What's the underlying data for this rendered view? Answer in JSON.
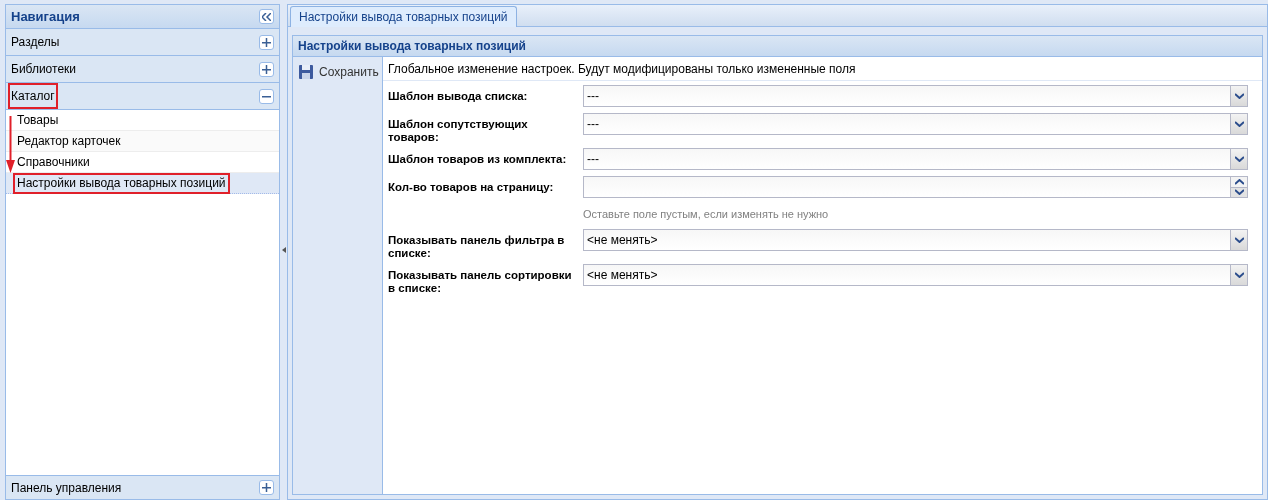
{
  "navigation": {
    "title": "Навигация",
    "sections": [
      {
        "label": "Разделы",
        "expanded": false,
        "highlighted": false
      },
      {
        "label": "Библиотеки",
        "expanded": false,
        "highlighted": false
      },
      {
        "label": "Каталог",
        "expanded": true,
        "highlighted": true,
        "items": [
          {
            "label": "Товары",
            "selected": false,
            "highlighted": false
          },
          {
            "label": "Редактор карточек",
            "selected": false,
            "highlighted": false
          },
          {
            "label": "Справочники",
            "selected": false,
            "highlighted": false
          },
          {
            "label": "Настройки вывода товарных позиций",
            "selected": true,
            "highlighted": true
          }
        ]
      }
    ],
    "footer_section": {
      "label": "Панель управления",
      "expanded": false
    }
  },
  "tabs": [
    {
      "label": "Настройки вывода товарных позиций",
      "selected": true
    }
  ],
  "panel": {
    "title": "Настройки вывода товарных позиций",
    "toolbar": [
      {
        "label": "Сохранить"
      }
    ],
    "info": "Глобальное изменение настроек. Будут модифицированы только измененные поля",
    "fields": [
      {
        "kind": "select",
        "label": "Шаблон вывода списка:",
        "value": "---"
      },
      {
        "kind": "select",
        "label": "Шаблон сопутствующих товаров:",
        "value": "---"
      },
      {
        "kind": "select",
        "label": "Шаблон товаров из комплекта:",
        "value": "---"
      },
      {
        "kind": "spinner",
        "label": "Кол-во товаров на страницу:",
        "hint": "Оставьте поле пустым, если изменять не нужно"
      },
      {
        "kind": "select",
        "label": "Показывать панель фильтра в списке:",
        "value": "<не менять>"
      },
      {
        "kind": "select",
        "label": "Показывать панель сортировки в списке:",
        "value": "<не менять>"
      }
    ]
  }
}
